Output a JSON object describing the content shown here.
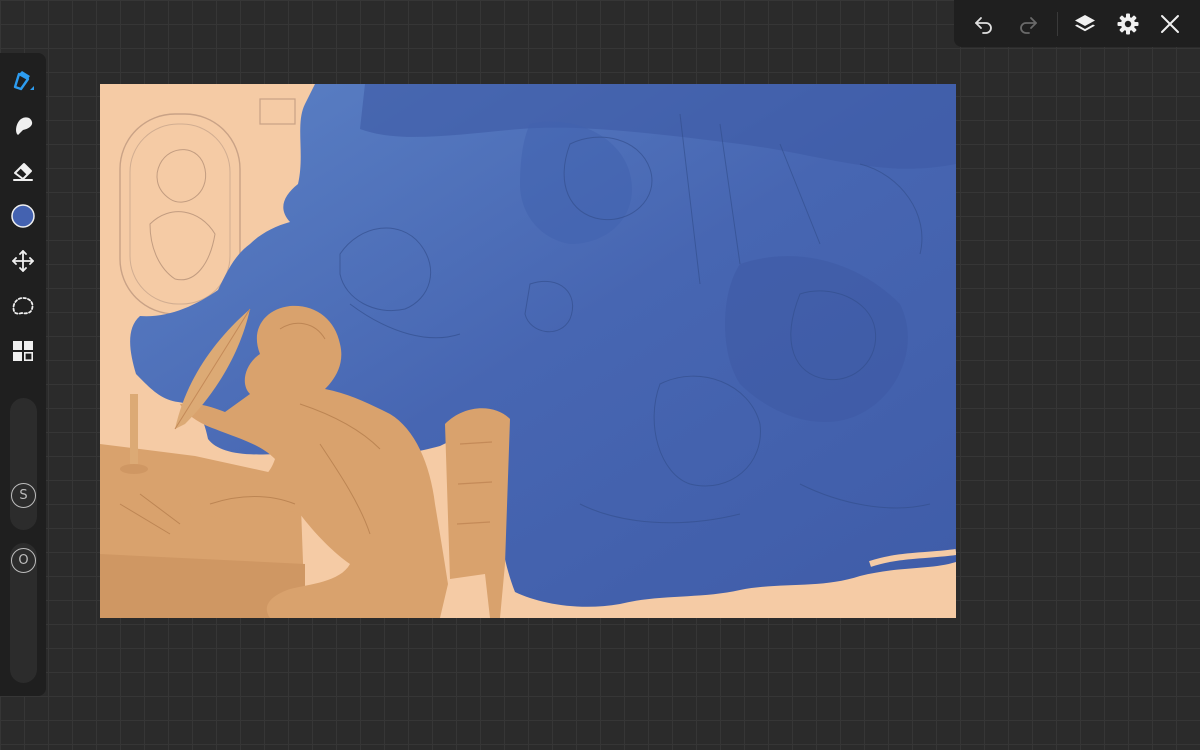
{
  "topbar": {
    "icons": [
      "undo-icon",
      "redo-icon",
      "layers-icon",
      "settings-icon",
      "close-icon"
    ]
  },
  "sidebar": {
    "tools": [
      "brush-icon",
      "smudge-icon",
      "eraser-icon",
      "color-swatch",
      "transform-icon",
      "lasso-select-icon",
      "layout-grid-icon"
    ],
    "active_color": "#4462b0",
    "size_slider": {
      "label": "S",
      "level": 0.55
    },
    "opacity_slider": {
      "label": "O",
      "level": 0.55
    }
  },
  "colors": {
    "accent": "#2d9cf0",
    "canvas_background": "#2b2b2b",
    "panel": "#1f1f1f",
    "artwork_skin": "#f5cba5",
    "artwork_blue": "#4a6cb6",
    "artwork_orange": "#d9a26d"
  }
}
